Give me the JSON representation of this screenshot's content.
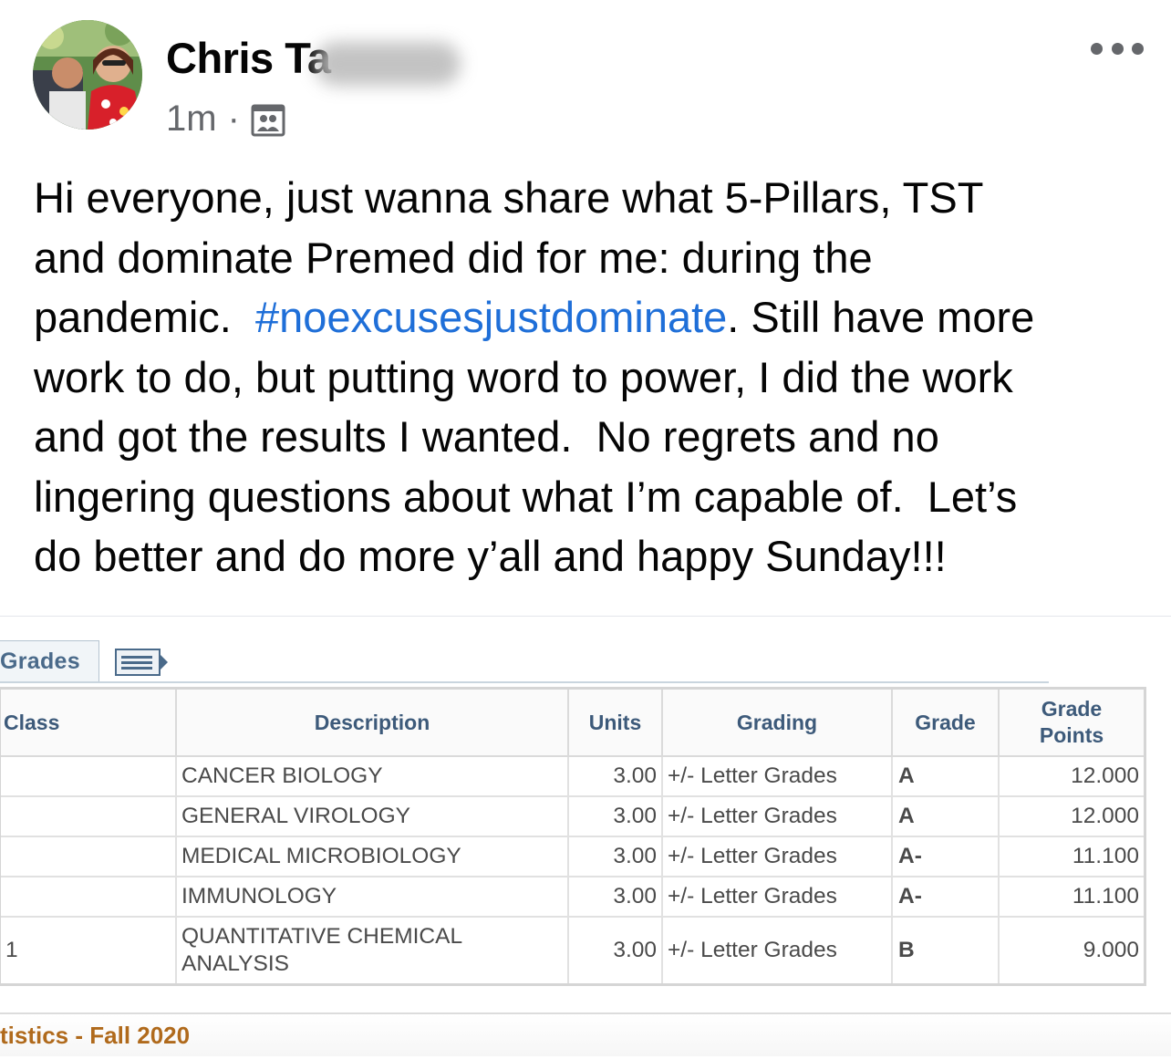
{
  "post": {
    "author_name": "Chris Ta",
    "timestamp": "1m",
    "separator": "·",
    "audience_icon": "group-audience-icon",
    "more_icon": "more-options-icon",
    "body": {
      "l1": "Hi everyone,  just wanna share what 5-Pillars, TST",
      "l2": "and dominate Premed did for me: during the",
      "l3a": "pandemic.  ",
      "hashtag": "#noexcusesjustdominate",
      "l3b": ". Still have more",
      "l4": "work to do, but putting word to power, I did the work",
      "l5": "and got the results I wanted.  No regrets and no",
      "l6": "lingering questions about what I’m capable of.  Let’s",
      "l7": "do better and do more y’all and happy Sunday!!!"
    },
    "colors": {
      "hashtag": "#1f6fd8",
      "meta": "#65676b"
    }
  },
  "grades": {
    "tab_label": "Grades",
    "headers": {
      "class": "Class",
      "description": "Description",
      "units": "Units",
      "grading": "Grading",
      "grade": "Grade",
      "grade_points_1": "Grade",
      "grade_points_2": "Points"
    },
    "rows": [
      {
        "class": "",
        "description": "CANCER BIOLOGY",
        "description_2": "",
        "units": "3.00",
        "grading": "+/- Letter Grades",
        "grade": "A",
        "grade_points": "12.000"
      },
      {
        "class": "",
        "description": "GENERAL VIROLOGY",
        "description_2": "",
        "units": "3.00",
        "grading": "+/- Letter Grades",
        "grade": "A",
        "grade_points": "12.000"
      },
      {
        "class": "",
        "description": "MEDICAL MICROBIOLOGY",
        "description_2": "",
        "units": "3.00",
        "grading": "+/- Letter Grades",
        "grade": "A-",
        "grade_points": "11.100"
      },
      {
        "class": "",
        "description": "IMMUNOLOGY",
        "description_2": "",
        "units": "3.00",
        "grading": "+/- Letter Grades",
        "grade": "A-",
        "grade_points": "11.100"
      },
      {
        "class": "1",
        "description": "QUANTITATIVE CHEMICAL",
        "description_2": "ANALYSIS",
        "units": "3.00",
        "grading": "+/- Letter Grades",
        "grade": "B",
        "grade_points": "9.000"
      }
    ],
    "stats_label": "tistics - Fall 2020"
  }
}
